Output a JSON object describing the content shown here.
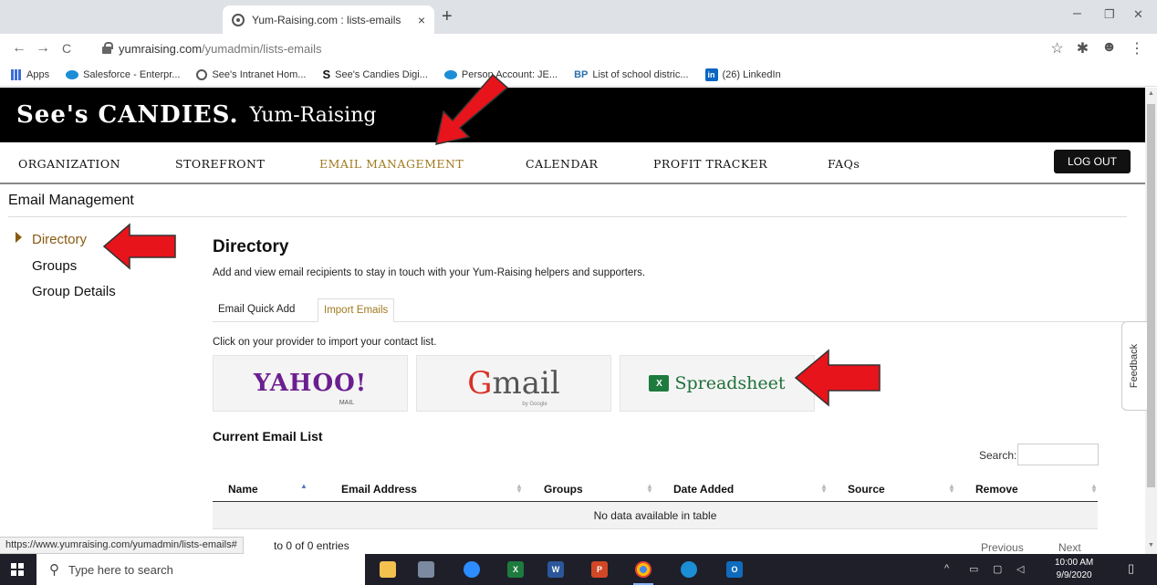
{
  "browser": {
    "tab_title": "Yum-Raising.com : lists-emails",
    "new_tab": "+",
    "close_tab": "×",
    "url_host": "yumraising.com",
    "url_path": "/yumadmin/lists-emails",
    "back": "←",
    "forward": "→",
    "reload": "C",
    "minimize": "–",
    "restore": "❐",
    "close": "✕",
    "bookmarks": [
      {
        "icon": "apps-icon",
        "label": "Apps"
      },
      {
        "icon": "salesforce-icon",
        "label": "Salesforce - Enterpr..."
      },
      {
        "icon": "globe-icon",
        "label": "See's Intranet Hom..."
      },
      {
        "icon": "s-icon",
        "label": "See's Candies Digi..."
      },
      {
        "icon": "salesforce-icon",
        "label": "Person Account: JE..."
      },
      {
        "icon": "bp-icon",
        "label": "List of school distric..."
      },
      {
        "icon": "linkedin-icon",
        "label": "(26) LinkedIn"
      }
    ],
    "status_url": "https://www.yumraising.com/yumadmin/lists-emails#"
  },
  "site": {
    "logo": "See's CANDIES.",
    "subtitle": "Yum-Raising",
    "nav": [
      "ORGANIZATION",
      "STOREFRONT",
      "EMAIL MANAGEMENT",
      "CALENDAR",
      "PROFIT TRACKER",
      "FAQs"
    ],
    "active_nav": "EMAIL MANAGEMENT",
    "logout": "LOG OUT",
    "accent": "#a07a1e"
  },
  "section_title": "Email Management",
  "sidebar": [
    {
      "label": "Directory",
      "active": true
    },
    {
      "label": "Groups",
      "active": false
    },
    {
      "label": "Group Details",
      "active": false
    }
  ],
  "main": {
    "heading": "Directory",
    "description": "Add and view email recipients to stay in touch with your Yum-Raising helpers and supporters.",
    "tabs": [
      {
        "label": "Email Quick Add",
        "selected": false
      },
      {
        "label": "Import Emails",
        "selected": true
      }
    ],
    "provider_prompt": "Click on your provider to import your contact list.",
    "providers": {
      "yahoo": "YAHOO!",
      "yahoo_sub": "MAIL",
      "gmail_g": "G",
      "gmail_rest": "mail",
      "gmail_sub": "by Google",
      "spreadsheet_icon": "X",
      "spreadsheet": "Spreadsheet"
    },
    "list_heading": "Current Email List",
    "search_label": "Search:",
    "search_value": "",
    "columns": [
      "Name",
      "Email Address",
      "Groups",
      "Date Added",
      "Source",
      "Remove"
    ],
    "empty_message": "No data available in table",
    "entries_text": "to 0 of 0 entries",
    "pager_prev": "Previous",
    "pager_next": "Next"
  },
  "feedback": "Feedback",
  "taskbar": {
    "search_placeholder": "Type here to search",
    "time": "10:00 AM",
    "date": "9/9/2020"
  },
  "annotation_color": "#e8141b"
}
